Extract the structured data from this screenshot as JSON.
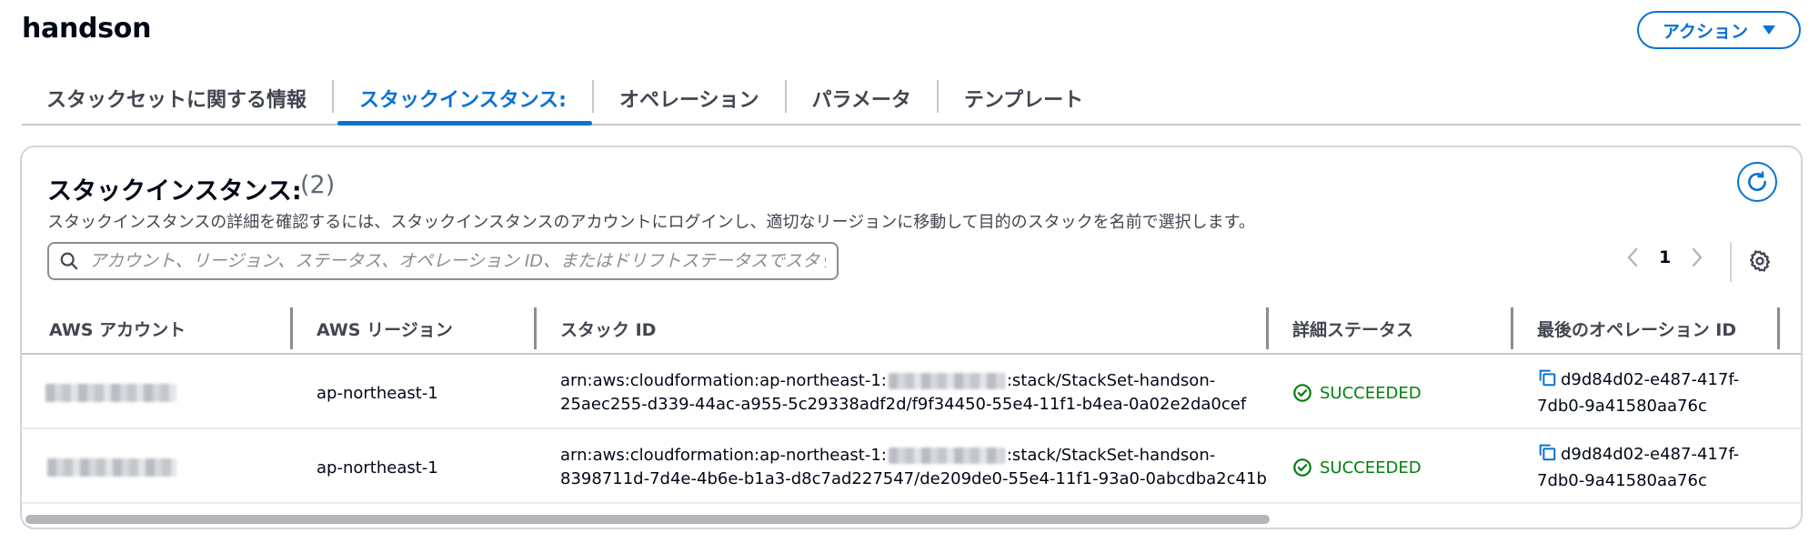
{
  "header": {
    "title": "handson",
    "action_label": "アクション"
  },
  "tabs": [
    {
      "label": "スタックセットに関する情報",
      "active": false
    },
    {
      "label": "スタックインスタンス:",
      "active": true
    },
    {
      "label": "オペレーション",
      "active": false
    },
    {
      "label": "パラメータ",
      "active": false
    },
    {
      "label": "テンプレート",
      "active": false
    }
  ],
  "section": {
    "title": "スタックインスタンス:",
    "count": "(2)",
    "description": "スタックインスタンスの詳細を確認するには、スタックインスタンスのアカウントにログインし、適切なリージョンに移動して目的のスタックを名前で選択します。"
  },
  "search": {
    "placeholder": "アカウント、リージョン、ステータス、オペレーション ID、またはドリフトステータスでスタッ"
  },
  "pagination": {
    "current_page": "1"
  },
  "table": {
    "columns": [
      "AWS アカウント",
      "AWS リージョン",
      "スタック ID",
      "詳細ステータス",
      "最後のオペレーション ID"
    ],
    "rows": [
      {
        "account": "",
        "region": "ap-northeast-1",
        "stack_id_prefix": "arn:aws:cloudformation:ap-northeast-1:",
        "stack_id_suffix": ":stack/StackSet-handson-",
        "stack_id_line2": "25aec255-d339-44ac-a955-5c29338adf2d/f9f34450-55e4-11f1-b4ea-0a02e2da0cef",
        "status": "SUCCEEDED",
        "op_id_line1": "d9d84d02-e487-417f-",
        "op_id_line2": "7db0-9a41580aa76c"
      },
      {
        "account": "",
        "region": "ap-northeast-1",
        "stack_id_prefix": "arn:aws:cloudformation:ap-northeast-1:",
        "stack_id_suffix": ":stack/StackSet-handson-",
        "stack_id_line2": "8398711d-7d4e-4b6e-b1a3-d8c7ad227547/de209de0-55e4-11f1-93a0-0abcdba2c41b",
        "status": "SUCCEEDED",
        "op_id_line1": "d9d84d02-e487-417f-",
        "op_id_line2": "7db0-9a41580aa76c"
      }
    ]
  },
  "colors": {
    "accent": "#0972d3",
    "success": "#037f0c",
    "text": "#000716",
    "muted": "#424650"
  },
  "icons": {
    "action_caret": "caret-down-icon",
    "refresh": "refresh-icon",
    "search": "search-icon",
    "prev": "chevron-left-icon",
    "next": "chevron-right-icon",
    "settings": "gear-icon",
    "status": "check-circle-icon",
    "copy": "copy-icon"
  }
}
